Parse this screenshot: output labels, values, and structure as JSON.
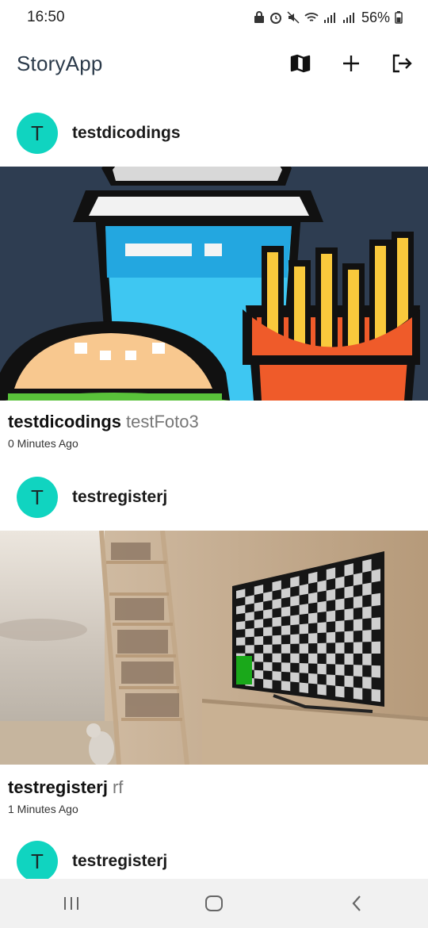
{
  "status_bar": {
    "time": "16:50",
    "battery": "56%"
  },
  "app_bar": {
    "title": "StoryApp",
    "actions": [
      "map-icon",
      "add-icon",
      "logout-icon"
    ]
  },
  "stories": [
    {
      "avatar_letter": "T",
      "username": "testdicodings",
      "caption_user": "testdicodings",
      "description": "testFoto3",
      "time": "0 Minutes Ago"
    },
    {
      "avatar_letter": "T",
      "username": "testregisterj",
      "caption_user": "testregisterj",
      "description": "rf",
      "time": "1 Minutes Ago"
    },
    {
      "avatar_letter": "T",
      "username": "testregisterj"
    }
  ],
  "colors": {
    "avatar": "#10d4c0",
    "title": "#2b3a4a",
    "nav_bg": "#f1f1f1"
  },
  "nav": [
    "recents-icon",
    "home-icon",
    "back-icon"
  ]
}
